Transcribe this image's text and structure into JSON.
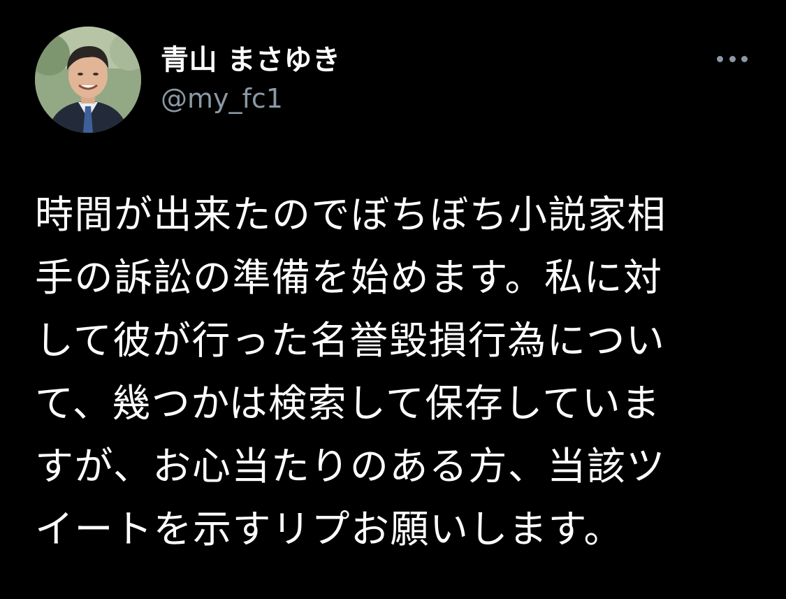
{
  "tweet": {
    "author": {
      "display_name": "青山 まさゆき",
      "handle": "@my_fc1",
      "avatar_icon": "profile-photo"
    },
    "more_icon": "more-horizontal-icon",
    "text_lines": [
      "時間が出来たのでぼちぼち小説家相",
      "手の訴訟の準備を始めます。私に対",
      "して彼が行った名誉毀損行為につい",
      "て、幾つかは検索して保存していま",
      "すが、お心当たりのある方、当該ツ",
      "イートを示すリプお願いします。"
    ]
  },
  "colors": {
    "background": "#000000",
    "primary_text": "#ffffff",
    "secondary_text": "#8b98a5"
  }
}
